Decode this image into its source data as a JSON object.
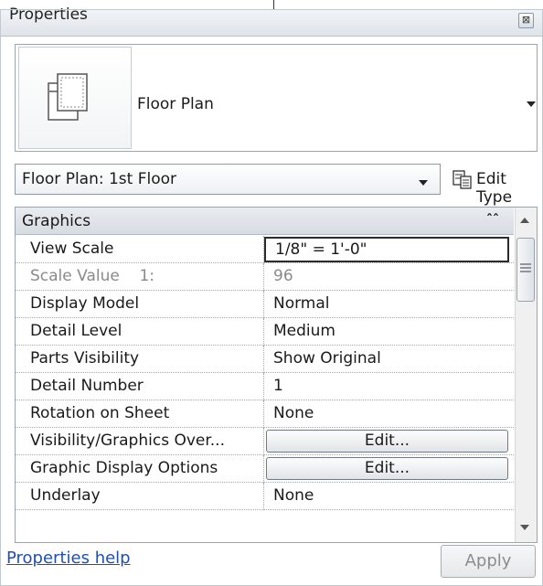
{
  "window": {
    "title": "Properties",
    "close_glyph": "⊠"
  },
  "type_selector": {
    "thumbnail_icon": "floor-plan-view-icon",
    "type_name": "Floor Plan"
  },
  "instance_selector": {
    "selected": "Floor Plan: 1st Floor",
    "edit_type_label": "Edit Type",
    "edit_type_icon": "edit-type-icon"
  },
  "grid": {
    "group": {
      "label": "Graphics",
      "collapse_glyph": "ˆ"
    },
    "rows": [
      {
        "name": "View Scale",
        "value": "1/8\" = 1'-0\""
      },
      {
        "name": "Scale Value    1:",
        "value": "96"
      },
      {
        "name": "Display Model",
        "value": "Normal"
      },
      {
        "name": "Detail Level",
        "value": "Medium"
      },
      {
        "name": "Parts Visibility",
        "value": "Show Original"
      },
      {
        "name": "Detail Number",
        "value": "1"
      },
      {
        "name": "Rotation on Sheet",
        "value": "None"
      },
      {
        "name": "Visibility/Graphics Over...",
        "value": "Edit..."
      },
      {
        "name": "Graphic Display Options",
        "value": "Edit..."
      },
      {
        "name": "Underlay",
        "value": "None"
      }
    ]
  },
  "footer": {
    "help_link": "Properties help",
    "apply_label": "Apply"
  },
  "colors": {
    "link": "#1f4fb3",
    "disabled_text": "#8a8a8a",
    "header_bg": "#dfe4ea"
  }
}
